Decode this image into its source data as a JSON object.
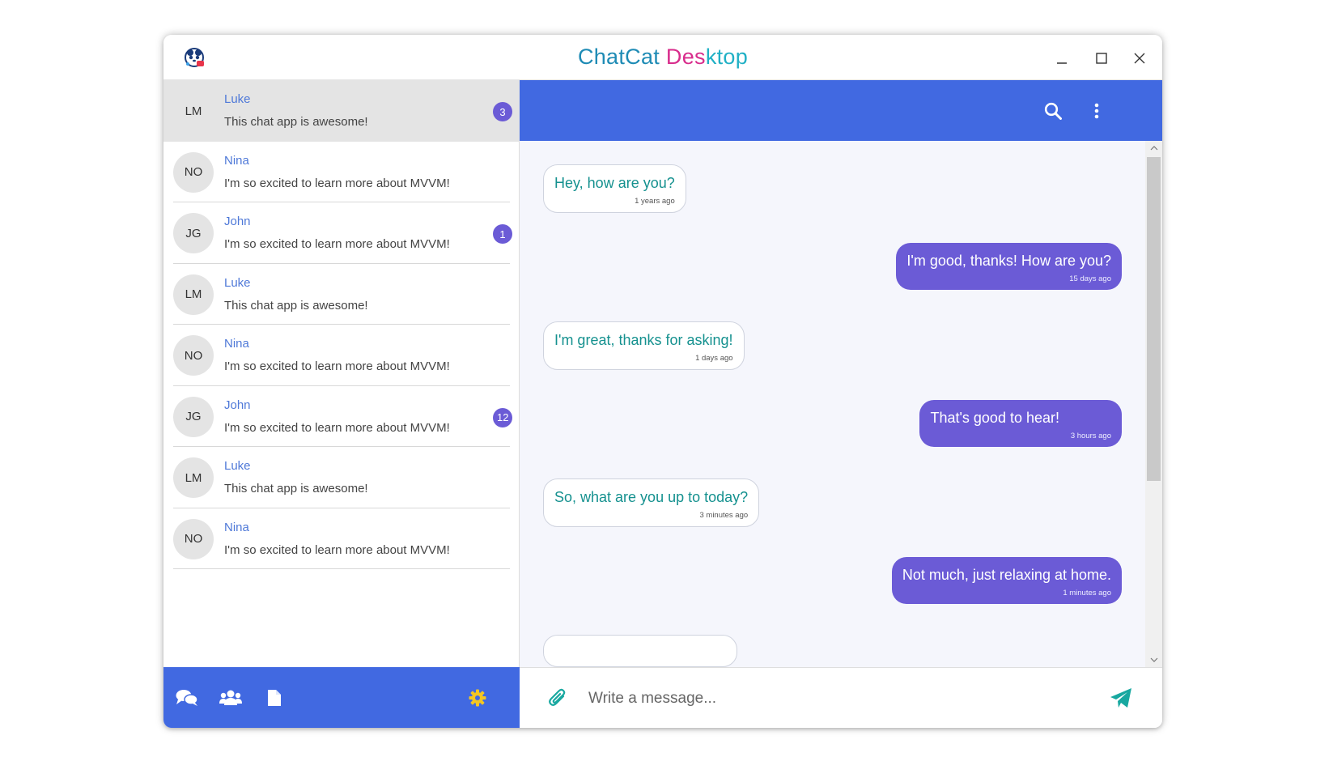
{
  "window": {
    "title_part1": "ChatCat",
    "title_part2": " Des",
    "title_part3": "ktop",
    "minimize": "_",
    "close": "X"
  },
  "colors": {
    "accent": "#4169e1",
    "bubble_out": "#6b5bd6",
    "bubble_in_text": "#15918f",
    "badge": "#6b5bd6",
    "name": "#4f79d8"
  },
  "chats": [
    {
      "initials": "LM",
      "name": "Luke",
      "preview": "This chat app is awesome!",
      "badge": "3"
    },
    {
      "initials": "NO",
      "name": "Nina",
      "preview": "I'm so excited to learn more about MVVM!",
      "badge": ""
    },
    {
      "initials": "JG",
      "name": "John",
      "preview": "I'm so excited to learn more about MVVM!",
      "badge": "1"
    },
    {
      "initials": "LM",
      "name": "Luke",
      "preview": "This chat app is awesome!",
      "badge": ""
    },
    {
      "initials": "NO",
      "name": "Nina",
      "preview": "I'm so excited to learn more about MVVM!",
      "badge": ""
    },
    {
      "initials": "JG",
      "name": "John",
      "preview": "I'm so excited to learn more about MVVM!",
      "badge": "12"
    },
    {
      "initials": "LM",
      "name": "Luke",
      "preview": "This chat app is awesome!",
      "badge": ""
    },
    {
      "initials": "NO",
      "name": "Nina",
      "preview": "I'm so excited to learn more about MVVM!",
      "badge": ""
    }
  ],
  "sidebar_nav": {
    "icons": [
      "chats-icon",
      "contacts-icon",
      "files-icon",
      "settings-icon"
    ]
  },
  "header": {
    "icons": [
      "search-icon",
      "more-vertical-icon"
    ]
  },
  "messages": [
    {
      "direction": "in",
      "text": "Hey, how are you?",
      "time": "1 years ago"
    },
    {
      "direction": "out",
      "text": "I'm good, thanks! How are you?",
      "time": "15 days ago"
    },
    {
      "direction": "in",
      "text": "I'm great, thanks for asking!",
      "time": "1 days ago"
    },
    {
      "direction": "out",
      "text": "That's good to hear!",
      "time": "3 hours ago"
    },
    {
      "direction": "in",
      "text": "So, what are you up to today?",
      "time": "3 minutes ago"
    },
    {
      "direction": "out",
      "text": "Not much, just relaxing at home.",
      "time": "1 minutes ago"
    }
  ],
  "composer": {
    "placeholder": "Write a message..."
  }
}
